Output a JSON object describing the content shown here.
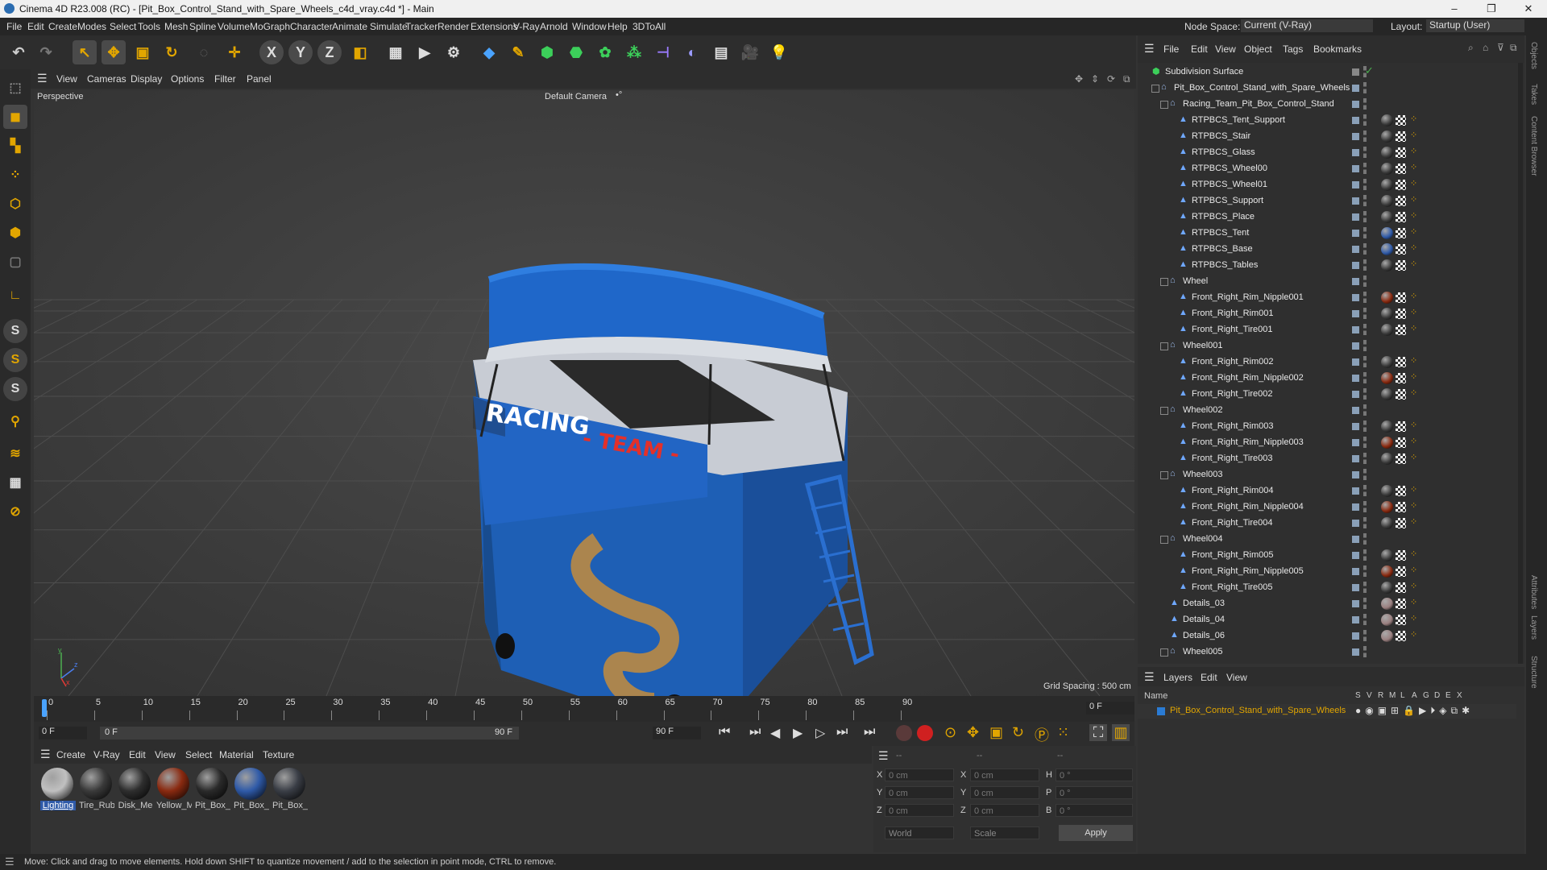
{
  "window": {
    "title": "Cinema 4D R23.008 (RC) - [Pit_Box_Control_Stand_with_Spare_Wheels_c4d_vray.c4d *] - Main",
    "min": "–",
    "max": "❐",
    "close": "✕"
  },
  "menubar": {
    "items": [
      "File",
      "Edit",
      "Create",
      "Modes",
      "Select",
      "Tools",
      "Mesh",
      "Spline",
      "Volume",
      "MoGraph",
      "Character",
      "Animate",
      "Simulate",
      "Tracker",
      "Render",
      "Extensions",
      "V-Ray",
      "Arnold",
      "Window",
      "Help",
      "3DToAll"
    ],
    "node_space_label": "Node Space:",
    "node_space_value": "Current (V-Ray)",
    "layout_label": "Layout:",
    "layout_value": "Startup (User)"
  },
  "viewport": {
    "menu": [
      "View",
      "Cameras",
      "Display",
      "Options",
      "Filter",
      "Panel"
    ],
    "label": "Perspective",
    "camera": "Default Camera",
    "camera_icon": "•°",
    "grid_spacing": "Grid Spacing : 500 cm",
    "axis_y": "y",
    "axis_z": "z",
    "axis_x": "x",
    "model_text_1": "RACING",
    "model_text_2": "- TEAM -"
  },
  "timeline": {
    "ticks": [
      "0",
      "5",
      "10",
      "15",
      "20",
      "25",
      "30",
      "35",
      "40",
      "45",
      "50",
      "55",
      "60",
      "65",
      "70",
      "75",
      "80",
      "85",
      "90"
    ],
    "current_frame": "0 F"
  },
  "transport": {
    "start": "0 F",
    "range_start": "0 F",
    "range_end": "90 F",
    "end": "90 F"
  },
  "materials": {
    "menu": [
      "Create",
      "V-Ray",
      "Edit",
      "View",
      "Select",
      "Material",
      "Texture"
    ],
    "items": [
      {
        "label": "Lighting",
        "color": "#c0c0c0"
      },
      {
        "label": "Tire_Rub",
        "color": "#3a3a3a"
      },
      {
        "label": "Disk_Me",
        "color": "#2e2e2e"
      },
      {
        "label": "Yellow_M",
        "color": "#8a2a10"
      },
      {
        "label": "Pit_Box_(",
        "color": "#2a2a2a"
      },
      {
        "label": "Pit_Box_",
        "color": "#2f5aa8"
      },
      {
        "label": "Pit_Box_l",
        "color": "#3a3e46"
      }
    ]
  },
  "coords": {
    "header": [
      "--",
      "--",
      "--"
    ],
    "rows": [
      {
        "a": "X",
        "av": "0 cm",
        "b": "X",
        "bv": "0 cm",
        "c": "H",
        "cv": "0 °"
      },
      {
        "a": "Y",
        "av": "0 cm",
        "b": "Y",
        "bv": "0 cm",
        "c": "P",
        "cv": "0 °"
      },
      {
        "a": "Z",
        "av": "0 cm",
        "b": "Z",
        "bv": "0 cm",
        "c": "B",
        "cv": "0 °"
      }
    ],
    "world": "World",
    "scale": "Scale",
    "apply": "Apply"
  },
  "status": {
    "text": "Move: Click and drag to move elements. Hold down SHIFT to quantize movement / add to the selection in point mode, CTRL to remove."
  },
  "object_manager": {
    "menu": [
      "File",
      "Edit",
      "View",
      "Object",
      "Tags",
      "Bookmarks"
    ],
    "rows": [
      {
        "name": "Subdivision Surface",
        "depth": 0,
        "kind": "subdiv",
        "tags": 0
      },
      {
        "name": "Pit_Box_Control_Stand_with_Spare_Wheels",
        "depth": 1,
        "kind": "null",
        "tags": 0
      },
      {
        "name": "Racing_Team_Pit_Box_Control_Stand",
        "depth": 2,
        "kind": "null",
        "tags": 0
      },
      {
        "name": "RTPBCS_Tent_Support",
        "depth": 3,
        "kind": "mesh",
        "tags": 1
      },
      {
        "name": "RTPBCS_Stair",
        "depth": 3,
        "kind": "mesh",
        "tags": 1
      },
      {
        "name": "RTPBCS_Glass",
        "depth": 3,
        "kind": "mesh",
        "tags": 1
      },
      {
        "name": "RTPBCS_Wheel00",
        "depth": 3,
        "kind": "mesh",
        "tags": 1
      },
      {
        "name": "RTPBCS_Wheel01",
        "depth": 3,
        "kind": "mesh",
        "tags": 1
      },
      {
        "name": "RTPBCS_Support",
        "depth": 3,
        "kind": "mesh",
        "tags": 1
      },
      {
        "name": "RTPBCS_Place",
        "depth": 3,
        "kind": "mesh",
        "tags": 1
      },
      {
        "name": "RTPBCS_Tent",
        "depth": 3,
        "kind": "mesh",
        "tags": 2
      },
      {
        "name": "RTPBCS_Base",
        "depth": 3,
        "kind": "mesh",
        "tags": 2
      },
      {
        "name": "RTPBCS_Tables",
        "depth": 3,
        "kind": "mesh",
        "tags": 1
      },
      {
        "name": "Wheel",
        "depth": 2,
        "kind": "null",
        "tags": 0
      },
      {
        "name": "Front_Right_Rim_Nipple001",
        "depth": 3,
        "kind": "mesh",
        "tags": 3
      },
      {
        "name": "Front_Right_Rim001",
        "depth": 3,
        "kind": "mesh",
        "tags": 1
      },
      {
        "name": "Front_Right_Tire001",
        "depth": 3,
        "kind": "mesh",
        "tags": 1
      },
      {
        "name": "Wheel001",
        "depth": 2,
        "kind": "null",
        "tags": 0
      },
      {
        "name": "Front_Right_Rim002",
        "depth": 3,
        "kind": "mesh",
        "tags": 1
      },
      {
        "name": "Front_Right_Rim_Nipple002",
        "depth": 3,
        "kind": "mesh",
        "tags": 3
      },
      {
        "name": "Front_Right_Tire002",
        "depth": 3,
        "kind": "mesh",
        "tags": 1
      },
      {
        "name": "Wheel002",
        "depth": 2,
        "kind": "null",
        "tags": 0
      },
      {
        "name": "Front_Right_Rim003",
        "depth": 3,
        "kind": "mesh",
        "tags": 1
      },
      {
        "name": "Front_Right_Rim_Nipple003",
        "depth": 3,
        "kind": "mesh",
        "tags": 3
      },
      {
        "name": "Front_Right_Tire003",
        "depth": 3,
        "kind": "mesh",
        "tags": 1
      },
      {
        "name": "Wheel003",
        "depth": 2,
        "kind": "null",
        "tags": 0
      },
      {
        "name": "Front_Right_Rim004",
        "depth": 3,
        "kind": "mesh",
        "tags": 1
      },
      {
        "name": "Front_Right_Rim_Nipple004",
        "depth": 3,
        "kind": "mesh",
        "tags": 3
      },
      {
        "name": "Front_Right_Tire004",
        "depth": 3,
        "kind": "mesh",
        "tags": 1
      },
      {
        "name": "Wheel004",
        "depth": 2,
        "kind": "null",
        "tags": 0
      },
      {
        "name": "Front_Right_Rim005",
        "depth": 3,
        "kind": "mesh",
        "tags": 1
      },
      {
        "name": "Front_Right_Rim_Nipple005",
        "depth": 3,
        "kind": "mesh",
        "tags": 3
      },
      {
        "name": "Front_Right_Tire005",
        "depth": 3,
        "kind": "mesh",
        "tags": 1
      },
      {
        "name": "Details_03",
        "depth": 2,
        "kind": "mesh",
        "tags": 4
      },
      {
        "name": "Details_04",
        "depth": 2,
        "kind": "mesh",
        "tags": 4
      },
      {
        "name": "Details_06",
        "depth": 2,
        "kind": "mesh",
        "tags": 4
      },
      {
        "name": "Wheel005",
        "depth": 2,
        "kind": "null",
        "tags": 0
      }
    ]
  },
  "layers": {
    "menu": [
      "Layers",
      "Edit",
      "View"
    ],
    "name_col": "Name",
    "cols": [
      "S",
      "V",
      "R",
      "M",
      "L",
      "A",
      "G",
      "D",
      "E",
      "X"
    ],
    "row": "Pit_Box_Control_Stand_with_Spare_Wheels",
    "row_color": "#2a7bd4"
  },
  "side_tabs": [
    "Objects",
    "Takes",
    "Content Browser",
    "Attributes",
    "Layers",
    "Structure"
  ],
  "colors": {
    "accent": "#e2a600",
    "blue": "#2f6fd0",
    "panel": "#2f2f2f"
  }
}
